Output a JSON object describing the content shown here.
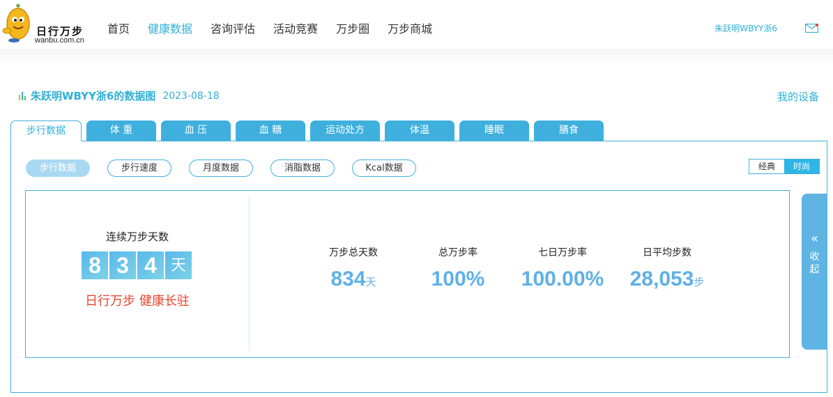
{
  "header": {
    "logo_title": "日行万步",
    "logo_sub": "wanbu.com.cn",
    "nav": [
      {
        "label": "首页",
        "active": false
      },
      {
        "label": "健康数据",
        "active": true
      },
      {
        "label": "咨询评估",
        "active": false
      },
      {
        "label": "活动竞赛",
        "active": false
      },
      {
        "label": "万步圈",
        "active": false
      },
      {
        "label": "万步商城",
        "active": false
      }
    ],
    "user_name": "朱跃明WBYY浙6",
    "mail_icon": "mail-icon"
  },
  "title_bar": {
    "title": "朱跃明WBYY浙6的数据图",
    "date": "2023-08-18",
    "my_device": "我的设备",
    "icon": "bar-chart-icon"
  },
  "tabs": [
    "步行数据",
    "体 重",
    "血 压",
    "血 糖",
    "运动处方",
    "体温",
    "睡眠",
    "膳食"
  ],
  "subtabs": [
    "步行数据",
    "步行速度",
    "月度数据",
    "消脂数据",
    "Kcal数据"
  ],
  "view_toggle": {
    "classic": "经典",
    "fashion": "时尚",
    "selected": "时尚"
  },
  "streak": {
    "label": "连续万步天数",
    "digits": [
      "8",
      "3",
      "4"
    ],
    "unit": "天",
    "slogan": "日行万步 健康长驻"
  },
  "stats": [
    {
      "label": "万步总天数",
      "value": "834",
      "unit": "天"
    },
    {
      "label": "总万步率",
      "value": "100%",
      "unit": ""
    },
    {
      "label": "七日万步率",
      "value": "100.00%",
      "unit": ""
    },
    {
      "label": "日平均步数",
      "value": "28,053",
      "unit": "步"
    }
  ],
  "collapse": {
    "arrow": "«",
    "line1": "收",
    "line2": "起"
  },
  "colors": {
    "accent": "#2fb0d8",
    "tab": "#3fb0dd",
    "stat": "#5fb0e8",
    "slogan": "#e8452f"
  }
}
